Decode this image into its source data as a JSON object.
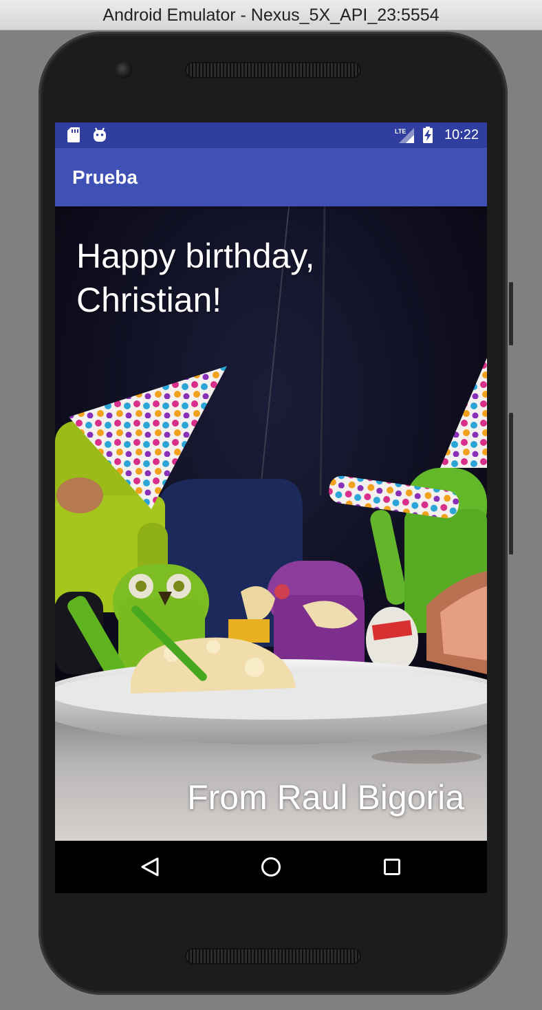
{
  "window": {
    "title": "Android Emulator - Nexus_5X_API_23:5554"
  },
  "status_bar": {
    "time": "10:22",
    "network_label": "LTE",
    "left_icons": [
      "sd-card-icon",
      "android-debug-icon"
    ],
    "right_icons": [
      "lte-signal-icon",
      "battery-charging-icon"
    ]
  },
  "app_bar": {
    "title": "Prueba"
  },
  "card": {
    "greeting": "Happy birthday, Christian!",
    "signature": "From Raul Bigoria"
  },
  "nav_bar": {
    "buttons": [
      "back-icon",
      "home-icon",
      "recents-icon"
    ]
  },
  "colors": {
    "status_bar": "#303f9f",
    "app_bar": "#3f51b5",
    "background_photo": "#0b0b1c"
  }
}
